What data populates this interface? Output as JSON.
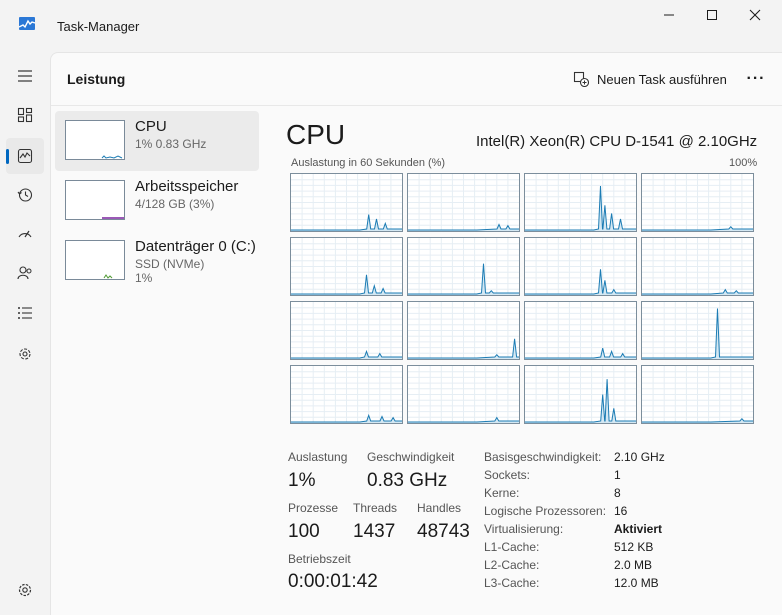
{
  "window": {
    "title": "Task-Manager"
  },
  "nav": {
    "items": [
      {
        "icon": "menu-icon"
      },
      {
        "icon": "processes-icon"
      },
      {
        "icon": "performance-icon",
        "active": true
      },
      {
        "icon": "app-history-icon"
      },
      {
        "icon": "startup-icon"
      },
      {
        "icon": "users-icon"
      },
      {
        "icon": "details-icon"
      },
      {
        "icon": "services-icon"
      },
      {
        "icon": "settings-icon"
      }
    ]
  },
  "header": {
    "page_title": "Leistung",
    "new_task_label": "Neuen Task ausführen",
    "more_label": "···"
  },
  "resources": [
    {
      "name": "CPU",
      "sub1": "1%  0.83 GHz",
      "sub2": ""
    },
    {
      "name": "Arbeitsspeicher",
      "sub1": "4/128 GB (3%)",
      "sub2": ""
    },
    {
      "name": "Datenträger 0 (C:)",
      "sub1": "SSD (NVMe)",
      "sub2": "1%"
    }
  ],
  "cpu": {
    "heading": "CPU",
    "model": "Intel(R) Xeon(R) CPU D-1541 @ 2.10GHz",
    "graph_label": "Auslastung in 60 Sekunden (%)",
    "graph_max": "100%",
    "stats": {
      "utilization_label": "Auslastung",
      "utilization_value": "1%",
      "speed_label": "Geschwindigkeit",
      "speed_value": "0.83 GHz",
      "processes_label": "Prozesse",
      "processes_value": "100",
      "threads_label": "Threads",
      "threads_value": "1437",
      "handles_label": "Handles",
      "handles_value": "48743",
      "uptime_label": "Betriebszeit",
      "uptime_value": "0:00:01:42"
    },
    "specs": [
      {
        "label": "Basisgeschwindigkeit:",
        "value": "2.10 GHz",
        "bold": false
      },
      {
        "label": "Sockets:",
        "value": "1",
        "bold": false
      },
      {
        "label": "Kerne:",
        "value": "8",
        "bold": false
      },
      {
        "label": "Logische Prozessoren:",
        "value": "16",
        "bold": false
      },
      {
        "label": "Virtualisierung:",
        "value": "Aktiviert",
        "bold": true
      },
      {
        "label": "L1-Cache:",
        "value": "512 KB",
        "bold": false
      },
      {
        "label": "L2-Cache:",
        "value": "2.0 MB",
        "bold": false
      },
      {
        "label": "L3-Cache:",
        "value": "12.0 MB",
        "bold": false
      }
    ]
  },
  "colors": {
    "graph_line": "#1c7cb4",
    "graph_fill": "#d4e8f3",
    "accent": "#0067c0",
    "disk_line": "#4f9a33"
  }
}
